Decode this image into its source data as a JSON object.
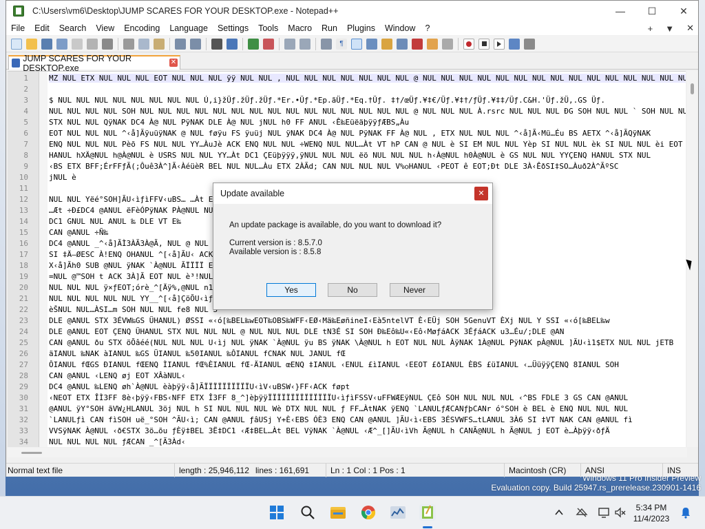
{
  "window": {
    "title": "C:\\Users\\vm6\\Desktop\\JUMP SCARES FOR YOUR DESKTOP.exe - Notepad++",
    "minimize_label": "—",
    "maximize_label": "☐",
    "close_label": "✕"
  },
  "menu": {
    "items": [
      "File",
      "Edit",
      "Search",
      "View",
      "Encoding",
      "Language",
      "Settings",
      "Tools",
      "Macro",
      "Run",
      "Plugins",
      "Window",
      "?"
    ],
    "right": [
      "+",
      "▼",
      "✕"
    ]
  },
  "tab": {
    "label": "JUMP SCARES FOR YOUR DESKTOP.exe",
    "close_label": "✕"
  },
  "editor": {
    "line_numbers": [
      "1",
      "2",
      "3",
      "4",
      "5",
      "6",
      "7",
      "8",
      "9",
      "10",
      "11",
      "12",
      "13",
      "14",
      "15",
      "16",
      "17",
      "18",
      "19",
      "20",
      "21",
      "22",
      "23",
      "24",
      "25",
      "26",
      "27",
      "28",
      "29",
      "30",
      "31",
      "32",
      "33",
      "34"
    ],
    "lines": [
      "MZ NUL ETX NUL NUL NUL EOT NUL NUL NUL ÿÿ NUL NUL , NUL NUL NUL NUL NUL NUL NUL @ NUL NUL NUL NUL NUL NUL NUL NUL NUL NUL NUL NUL NUL NUL NUL NUL",
      "",
      "$ NUL NUL NUL NUL NUL NUL NUL NUL Ú,i}žÜƒ.žÜƒ.žÜƒ.*Er.•Üƒ.*Ep.ãÜƒ.*Eq.†Üƒ.    ‡†/œÜƒ.¥‡€/Üƒ.¥‡†/ƒÜƒ.¥‡‡/Üƒ.C&H.'Üƒ.žÜ,.GS Üƒ.",
      "NUL NUL NUL NUL SOH NUL NUL NUL NUL NUL NUL NUL NUL NUL NUL NUL NUL NUL NUL NUL @ NUL NUL NUL À.rsrc NUL NUL NUL ÐG SOH NUL NUL ` SOH NUL NUL H SOH NUL NUL",
      "STX NUL NUL QÿNAK DC4 À@ NUL PÿNAK DLE À@ NUL jNUL h0 FF ANUL ‹Ê‰EüëäþÿÿƒÆBS„Àu",
      "EOT NUL NUL NUL ^‹å]ÃÿuüÿNAK @ NUL føÿu FS ÿuüj NUL ÿNAK DC4 À@ NUL PÿNAK FF À@ NUL , ETX NUL NUL NUL ^‹å]Ã‹Mü…Éu BS AETX ^‹å]ÃQÿNAK",
      "ENQ NUL NUL NUL Pèõ FS NUL NUL YY…ÀuJè ACK ENQ NUL NUL ÷WENQ NUL NUL…Àt VT hP CAN @ NUL è SI EM NUL NUL Yèp SI NUL NUL èk SI NUL NUL èi EOT NUL",
      "HANUL hXÄ@NUL h@À@NUL è USRS NUL NUL YY…Àt DC1 ÇEüþÿÿÿ,ÿNUL NUL NUL ëö NUL NUL NUL h‹À@NUL h0À@NUL è GS NUL NUL YYÇENQ HANUL STX NUL",
      "‹BS ETX BFF;ÉrFFƒÃ(;Ôuê3À^]Ã‹ÀéüèR BEL NUL NUL…Àu ETX 2ÀÃd; CAN NUL NUL NUL V%ѻHANUL ‹PEOT ê EOT;Ðt DLE 3À‹ÊðSI‡SO…Àuð2À^ÃºSC",
      "jNUL è",
      "",
      "NUL NUL Yëé°SOH]ÃU‹ìƒìFFV‹uBS…                                                     …Àt EOT 2ÀëWh¬HANUL èÜ#NUL NUL ÷ØY SUB A",
      "…Æt ÷Ð£DC4 @ANUL ëFèÓPÿNAK PÀ@NUL                                                   NUL ‹MŒEü3Mì3Mü3È;ÎuBEL¹Oæ@«èDLE…ÎuFF",
      "DC1 GNUL NUL ANUL ‰ DLE VT E‰",
      "CAN @ANUL ÷Ñ‰",
      "DC4 @ANUL _^‹å]ÃÌ3ÀÃ3À@Ã, NUL @                                                      NUL j NUL èA#NUL NUL ƒÄFF…Àu SOH Ãj BEL è",
      "SI ‡Ä–ØESC À!ENQ OHANUL ^[‹å]ÃU‹                                                      ACK SI ·ÈiëETX j",
      "X‹å]Ãh0 SUB @NUL ÿNAK `À@NUL ÃÏÏÏÏ                                                    EMt ESC =!ENQ \"EMt DC4 =\"ENQ \"EMt",
      "=NUL @™SOH t ACK 3À]Ã EOT NUL è³!NUL                                                  ÏèD NUL NUL NUL ÿ×ƒEOT;ór è_^[ÃÏÏÏÏÏÏÏ",
      "NUL NUL NUL ÿ×ƒEOT;órè_^[Äÿ%,@NUL                                                     n1$ DLE 1$ DLE +ãSVW;CAN @ANUL 1Eü3ÅP…",
      "NUL NUL NUL NUL NUL YY__^[‹å]ÇöÕU‹ìƒ%                                                  ",
      "èŠNUL NUL…ÀSI…m SOH NUL NUL fe8 NUL S",
      "DLE @ANUL STX 3ÉVW‰GS ÜHANUL) ØSSI «‹ó[‰BEL‰wEOT‰OBS‰WFF‹EØ‹Mä‰EøñineI‹Eà5ntelVT È‹EÜj SOH 5GenuVT ÈXj NUL Y SSI «‹ó[‰BEL‰w",
      "DLE @ANUL EOT ÇENQ ÜHANUL STX NUL NUL NUL @ NUL NUL NUL DLE tN3É SI SOH Ð‰Eô‰U«‹Eô‹MøƒáACK 3ÉƒáACK u3…Éu/;DLE @AN",
      "CAN @ANUL ðu STX öÕâéé(NUL NUL NUL U‹ìj NUL ÿNAK `À@NUL ÿu BS ÿNAK \\À@NUL h EOT NUL NUL ÀÿNAK 1À@NUL PÿNAK pÀ@NUL ]ÃU‹ì1$ETX NUL NUL jETB",
      "äIANUL ‰NAK àIANUL ‰GS ÜIANUL ‰50IANUL ‰ÔIANUL fCNAK NUL JANUL fŒ",
      "ÔIANUL fŒGS ÐIANUL fŒENQ ÌIANUL fŒ%ÈIANUL fŒ-ÄIANUL œENQ ‡IANUL ‹ENUL £ìIANUL ‹EEOT £ðIANUL ÈBS £üIANUL ‹…ÜüÿÿÇENQ 8IANUL SOH",
      "CAN @ANUL ‹LENQ øj EOT XÂàNUL‹",
      "DC4 @ANUL ‰LENQ øh`À@NUL èàþÿÿ‹å]ÃÏÏÏÏÏÏÏÏÏÏU‹ìV‹uBSW‹}FF‹ACK føpt",
      "‹NEOT ETX ÎÌ3FF 8è‹þÿÿ‹FBS‹NFF ETX Î3FF 8_^]èþÿÿÏÏÏÏÏÏÏÏÏÏÏÏÏÏU‹ìƒìFSSV‹uFFWÆEÿNUL ÇEô SOH NUL NUL NUL ‹^BS FDLE 3 GS CAN @ANUL",
      " @ANUL ÿY°SOH ãVW¿HLANUL 3öj NUL h  SI NUL NUL NUL Wè DTX NUL NUL ƒ FF…ÀtNAK ÿENQ `LANULƒÆCANƒþCANr ó°SOH è BEL è ENQ NUL NUL NUL",
      "`LANULƒì CAN fìSOH uë_°SOH ^ÃU‹ì; CAN @ANUL ƒâUSj Y+È‹EBS ÓÈ3 ENQ CAN @ANUL ]ÃU‹ì‹EBS 3ÉSVWFS…tLANUL 3À6 SI ‡VT NAK CAN @ANUL fì",
      "VVSÿNAK À@NUL ‹ð€STX 3ö…õu   ƒÈÿ‡BEL 3Ë‡DC1 ‹Æ‡BEL…Àt BEL VÿNAK `À@NUL ‹Æ^_[]ÃU‹ìVh Ã@NUL h CANÃ@NUL h Ã@NUL j EOT è…Àþÿÿ‹ðƒÄ",
      "NUL NUL NUL NUL ƒÆCAN _^[Ã3Àd‹"
    ]
  },
  "status": {
    "file_type": "Normal text file",
    "length": "length : 25,946,112",
    "lines": "lines : 161,691",
    "position": "Ln : 1    Col : 1    Pos : 1",
    "eol": "Macintosh (CR)",
    "encoding": "ANSI",
    "mode": "INS"
  },
  "dialog": {
    "title": "Update available",
    "close_label": "✕",
    "message": "An update package is available, do you want to download it?",
    "current_version": "Current version is   : 8.5.7.0",
    "available_version": "Available version is : 8.5.8",
    "buttons": {
      "yes": "Yes",
      "no": "No",
      "never": "Never"
    }
  },
  "watermark": {
    "line1": "Windows 11 Pro Insider Preview",
    "line2": "Evaluation copy. Build 25947.rs_prerelease.230901-1416"
  },
  "taskbar": {
    "time": "5:34 PM",
    "date": "11/4/2023",
    "icons": [
      "start-icon",
      "search-icon",
      "file-explorer-icon",
      "chrome-icon",
      "task-manager-icon",
      "notepad-plus-plus-icon"
    ],
    "tray_icons": [
      "chevron-up-icon",
      "network-off-icon",
      "display-icon",
      "volume-muted-icon",
      "notification-bell-icon"
    ]
  },
  "colors": {
    "accent": "#0078d7",
    "tab_active_border": "#f2a33a",
    "dialog_close": "#c4342a",
    "control_char_bg": "#000000"
  }
}
